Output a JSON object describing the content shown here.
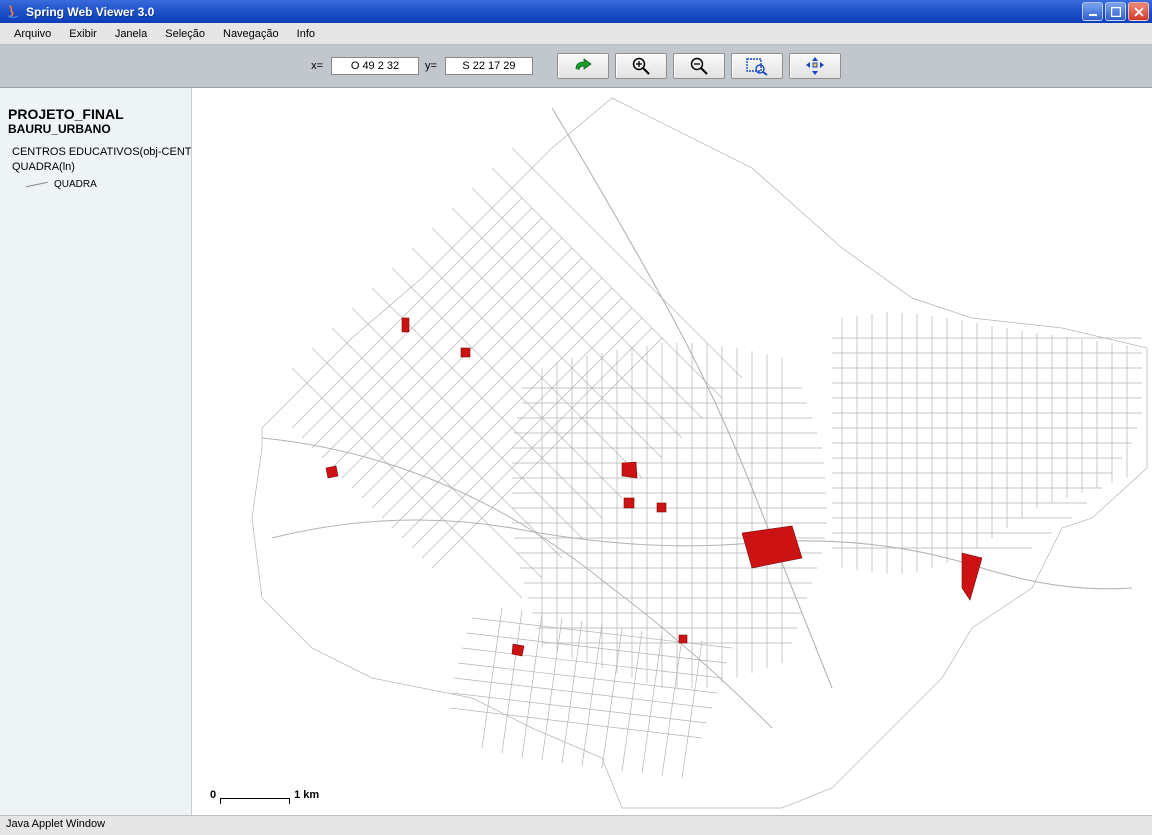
{
  "window": {
    "title": "Spring Web Viewer 3.0"
  },
  "menu": {
    "items": [
      "Arquivo",
      "Exibir",
      "Janela",
      "Seleção",
      "Navegação",
      "Info"
    ]
  },
  "toolbar": {
    "x_label": "x=",
    "y_label": "y=",
    "x_value": "O 49 2 32",
    "y_value": "S 22 17 29",
    "buttons": {
      "redo": "redo-arrow-icon",
      "zoom_in": "zoom-in-icon",
      "zoom_out": "zoom-out-icon",
      "zoom_area": "zoom-area-icon",
      "pan": "pan-cross-icon"
    }
  },
  "sidebar": {
    "project": "PROJETO_FINAL",
    "subproject": "BAURU_URBANO",
    "layers": [
      "CENTROS EDUCATIVOS(obj-CENT",
      "QUADRA(ln)"
    ],
    "legend_item": "QUADRA"
  },
  "scalebar": {
    "left": "0",
    "right": "1 km"
  },
  "statusbar": {
    "text": "Java Applet Window"
  }
}
